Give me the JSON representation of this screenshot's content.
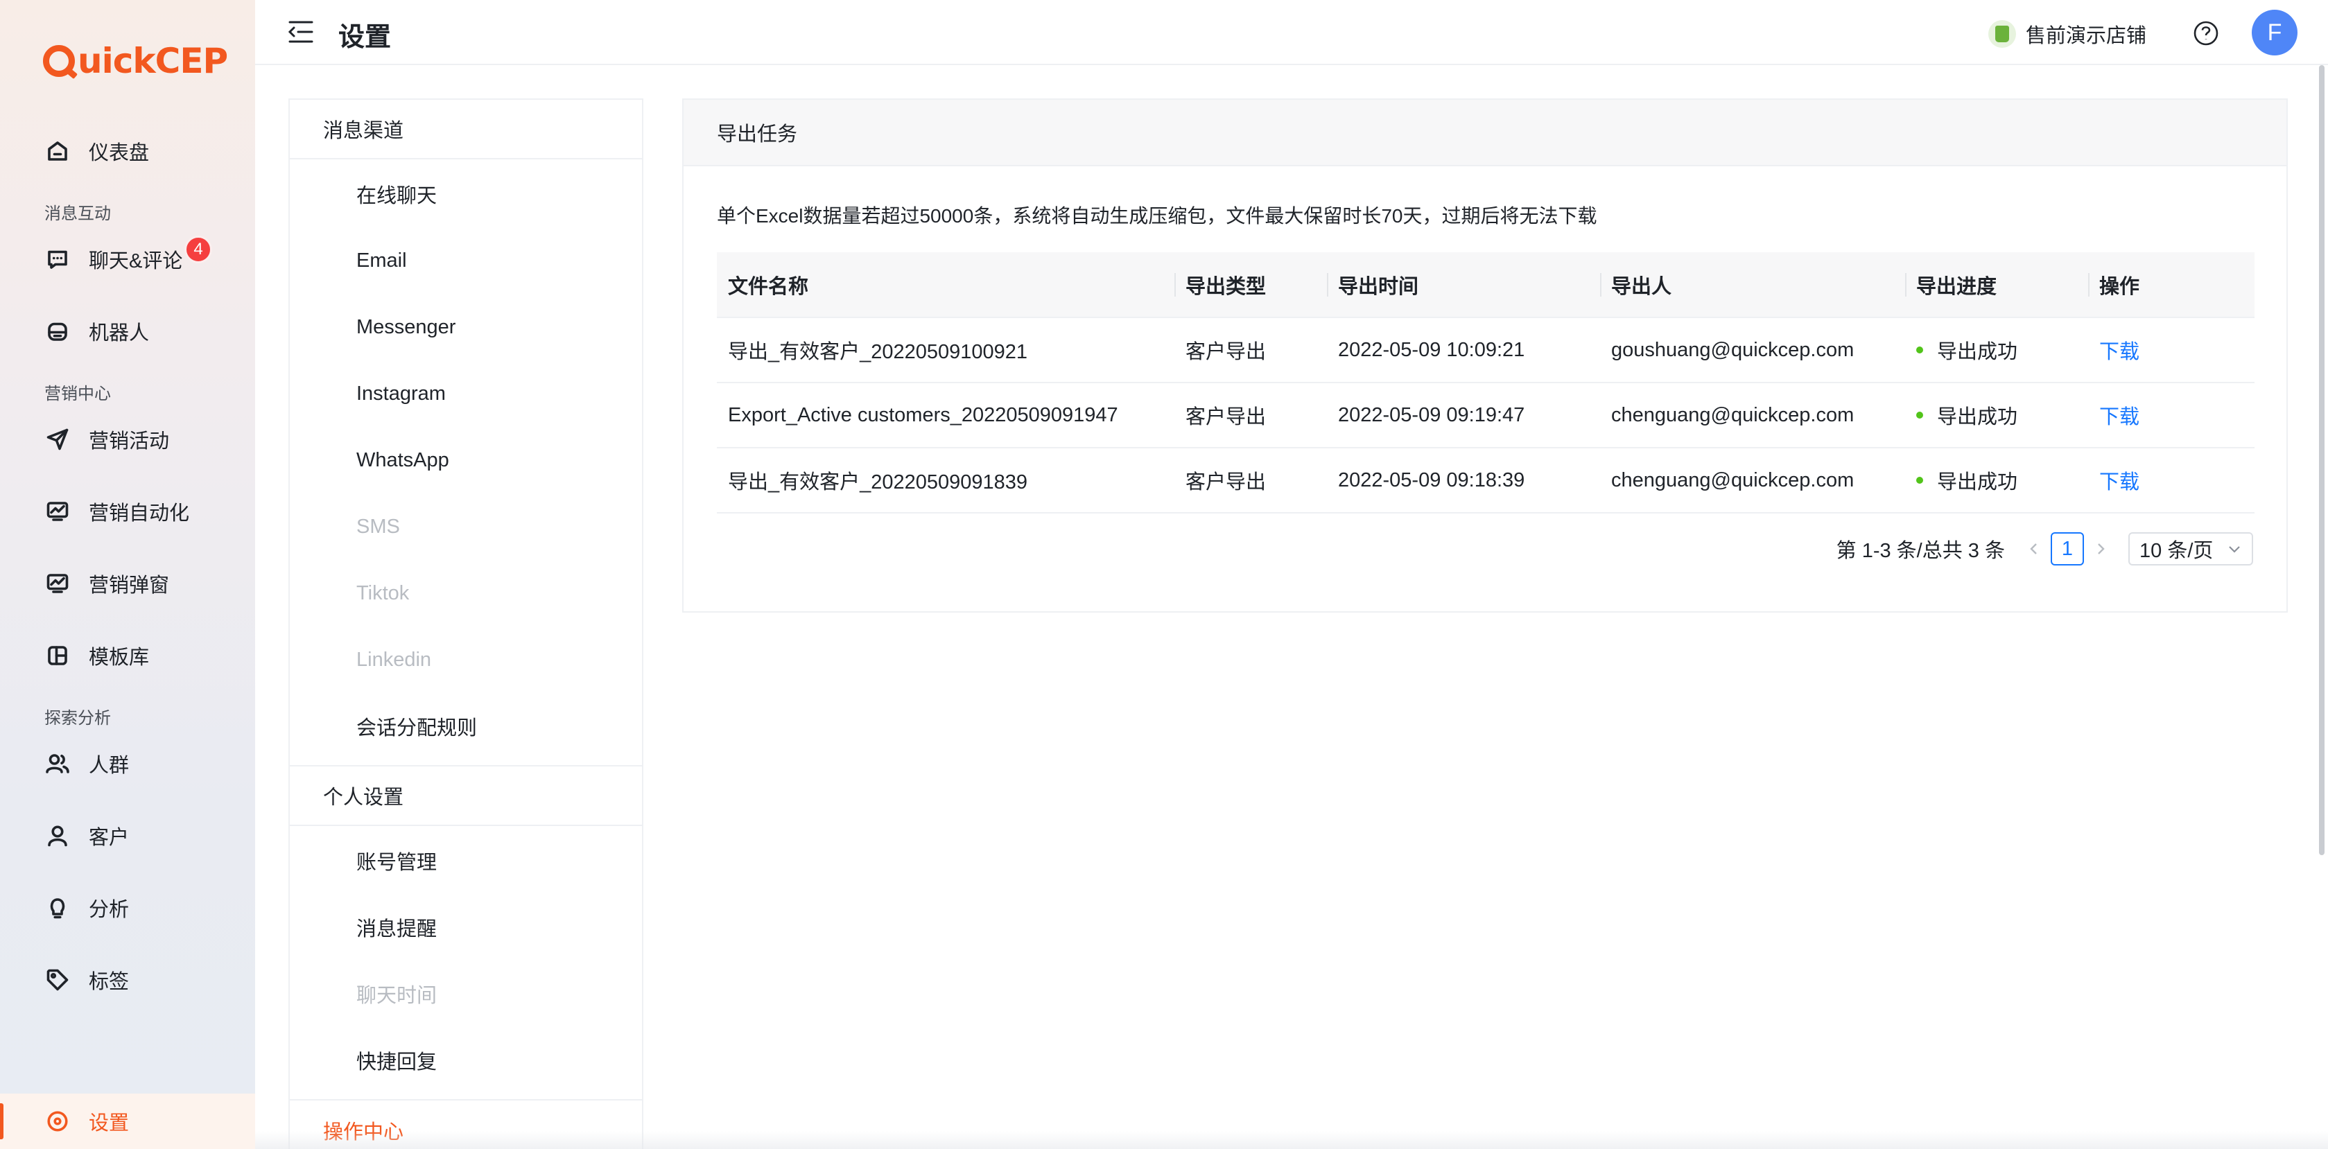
{
  "sidebar": {
    "logo": "QuickCEP",
    "items": [
      {
        "label": "仪表盘",
        "icon": "home-icon"
      },
      {
        "group": "消息互动"
      },
      {
        "label": "聊天&评论",
        "icon": "chat-icon",
        "badge": "4"
      },
      {
        "label": "机器人",
        "icon": "robot-icon"
      },
      {
        "group": "营销中心"
      },
      {
        "label": "营销活动",
        "icon": "send-icon"
      },
      {
        "label": "营销自动化",
        "icon": "automation-icon"
      },
      {
        "label": "营销弹窗",
        "icon": "popup-icon"
      },
      {
        "label": "模板库",
        "icon": "template-icon"
      },
      {
        "group": "探索分析"
      },
      {
        "label": "人群",
        "icon": "users-icon"
      },
      {
        "label": "客户",
        "icon": "user-icon"
      },
      {
        "label": "分析",
        "icon": "bulb-icon"
      },
      {
        "label": "标签",
        "icon": "tag-icon"
      },
      {
        "label": "设置",
        "icon": "settings-icon",
        "active": true
      }
    ]
  },
  "header": {
    "title": "设置",
    "store_name": "售前演示店铺",
    "avatar_letter": "F"
  },
  "submenu": {
    "channels_title": "消息渠道",
    "channels": [
      {
        "label": "在线聊天",
        "disabled": false
      },
      {
        "label": "Email",
        "disabled": false
      },
      {
        "label": "Messenger",
        "disabled": false
      },
      {
        "label": "Instagram",
        "disabled": false
      },
      {
        "label": "WhatsApp",
        "disabled": false
      },
      {
        "label": "SMS",
        "disabled": true
      },
      {
        "label": "Tiktok",
        "disabled": true
      },
      {
        "label": "Linkedin",
        "disabled": true
      },
      {
        "label": "会话分配规则",
        "disabled": false
      }
    ],
    "personal_title": "个人设置",
    "personal": [
      {
        "label": "账号管理",
        "disabled": false
      },
      {
        "label": "消息提醒",
        "disabled": false
      },
      {
        "label": "聊天时间",
        "disabled": true
      },
      {
        "label": "快捷回复",
        "disabled": false
      }
    ],
    "operations_title": "操作中心"
  },
  "export_card": {
    "title": "导出任务",
    "notice": "单个Excel数据量若超过50000条，系统将自动生成压缩包，文件最大保留时长70天，过期后将无法下载",
    "columns": [
      "文件名称",
      "导出类型",
      "导出时间",
      "导出人",
      "导出进度",
      "操作"
    ],
    "rows": [
      {
        "file": "导出_有效客户_20220509100921",
        "type": "客户导出",
        "time": "2022-05-09 10:09:21",
        "user": "goushuang@quickcep.com",
        "status": "导出成功",
        "action": "下载"
      },
      {
        "file": "Export_Active customers_20220509091947",
        "type": "客户导出",
        "time": "2022-05-09 09:19:47",
        "user": "chenguang@quickcep.com",
        "status": "导出成功",
        "action": "下载"
      },
      {
        "file": "导出_有效客户_20220509091839",
        "type": "客户导出",
        "time": "2022-05-09 09:18:39",
        "user": "chenguang@quickcep.com",
        "status": "导出成功",
        "action": "下载"
      }
    ],
    "pagination": {
      "total_text": "第 1-3 条/总共 3 条",
      "current_page": "1",
      "page_size": "10 条/页"
    }
  },
  "colors": {
    "brand": "#f2581f",
    "link": "#1677ff",
    "success": "#52c41a",
    "badge": "#f53f3f",
    "avatar": "#4f86f7"
  }
}
